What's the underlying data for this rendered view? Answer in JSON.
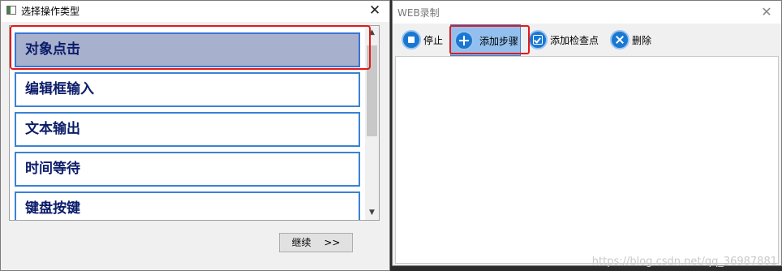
{
  "left_dialog": {
    "title": "选择操作类型",
    "close_glyph": "✕",
    "operations": [
      {
        "label": "对象点击",
        "selected": true
      },
      {
        "label": "编辑框输入",
        "selected": false
      },
      {
        "label": "文本输出",
        "selected": false
      },
      {
        "label": "时间等待",
        "selected": false
      },
      {
        "label": "键盘按键",
        "selected": false
      }
    ],
    "continue_button": "继续　 >>"
  },
  "right_dialog": {
    "title": "WEB录制",
    "close_glyph": "✕",
    "toolbar": {
      "stop": {
        "label": "停止",
        "icon": "stop-icon"
      },
      "add_step": {
        "label": "添加步骤",
        "icon": "plus-circle-icon"
      },
      "add_checkpoint": {
        "label": "添加检查点",
        "icon": "checkbox-icon"
      },
      "delete": {
        "label": "删除",
        "icon": "close-circle-icon"
      }
    }
  },
  "watermark": "https://blog.csdn.net/qq_36987881",
  "colors": {
    "accent_blue": "#1a78d2",
    "selection_bg": "#a7b0cd",
    "item_text": "#0b1c6a",
    "highlight_red": "#e11a1a"
  }
}
